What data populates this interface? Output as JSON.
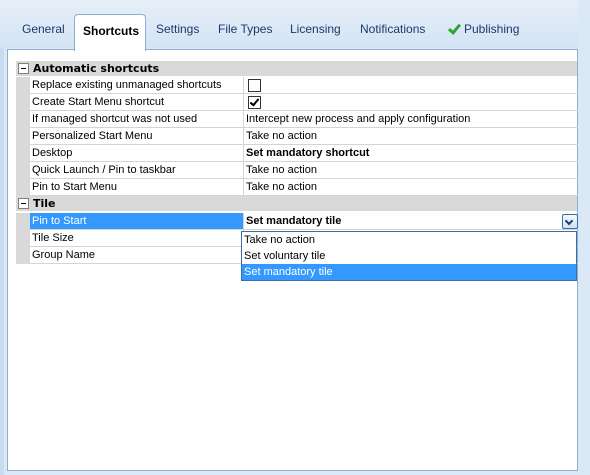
{
  "tabs": [
    {
      "label": "General"
    },
    {
      "label": "Shortcuts"
    },
    {
      "label": "Settings"
    },
    {
      "label": "File Types"
    },
    {
      "label": "Licensing"
    },
    {
      "label": "Notifications"
    },
    {
      "label": "Publishing",
      "icon": "check-icon"
    }
  ],
  "active_tab": "Shortcuts",
  "categories": {
    "automatic": "Automatic shortcuts",
    "tile": "Tile"
  },
  "properties": {
    "replace_existing": {
      "label": "Replace existing unmanaged shortcuts",
      "checked": false
    },
    "create_start_menu": {
      "label": "Create Start Menu shortcut",
      "checked": true
    },
    "if_managed_not_used": {
      "label": "If managed shortcut was not used",
      "value": "Intercept new process and apply configuration"
    },
    "personalized_start_menu": {
      "label": "Personalized Start Menu",
      "value": "Take no action"
    },
    "desktop": {
      "label": "Desktop",
      "value": "Set mandatory shortcut"
    },
    "quick_launch": {
      "label": "Quick Launch / Pin to taskbar",
      "value": "Take no action"
    },
    "pin_to_start_menu": {
      "label": "Pin to Start Menu",
      "value": "Take no action"
    },
    "pin_to_start": {
      "label": "Pin to Start",
      "value": "Set mandatory tile"
    },
    "tile_size": {
      "label": "Tile Size"
    },
    "group_name": {
      "label": "Group Name"
    }
  },
  "dropdown_options": [
    "Take no action",
    "Set voluntary tile",
    "Set mandatory tile"
  ],
  "dropdown_selected": "Set mandatory tile",
  "colors": {
    "selection": "#3399ff",
    "tab_text": "#1a3a6b",
    "category_bg": "#d9d9d9",
    "check_green": "#2fa52f"
  }
}
